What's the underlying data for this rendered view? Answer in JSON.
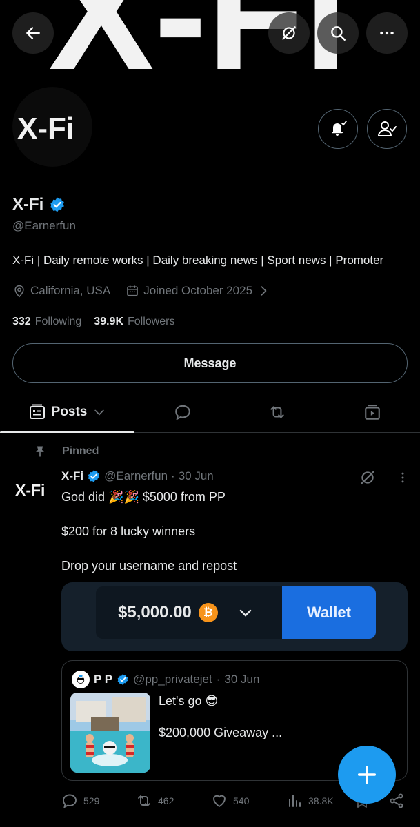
{
  "banner": {
    "logo_text": "X-Fi",
    "icons": [
      "back-arrow-icon",
      "grok-icon",
      "search-icon",
      "more-icon"
    ]
  },
  "avatar": {
    "logo_text": "X-Fi"
  },
  "profile": {
    "name": "X-Fi",
    "handle": "@Earnerfun",
    "bio": "X-Fi | Daily remote works | Daily breaking news | Sport news | Promoter",
    "location": "California, USA",
    "joined": "Joined October 2025",
    "following_count": "332",
    "following_label": "Following",
    "followers_count": "39.9K",
    "followers_label": "Followers"
  },
  "buttons": {
    "message": "Message"
  },
  "tabs": {
    "posts": "Posts"
  },
  "post": {
    "pinned_label": "Pinned",
    "author_name": "X-Fi",
    "author_handle": "@Earnerfun",
    "dot": "·",
    "date": "30 Jun",
    "line1": "God did 🎉🎉 $5000 from PP",
    "line2": "$200 for 8 lucky winners",
    "line3": "Drop your username and repost",
    "wallet_amount": "$5,000.00",
    "wallet_coin": "₿",
    "wallet_button": "Wallet",
    "quote": {
      "author_name": "P P",
      "author_handle": "@pp_privatejet",
      "dot": "·",
      "date": "30 Jun",
      "line1": "Let's go 😎",
      "line2": "$200,000 Giveaway ..."
    },
    "stats": {
      "replies": "529",
      "reposts": "462",
      "likes": "540",
      "views": "38.8K"
    }
  },
  "colors": {
    "accent": "#1d9bf0",
    "muted": "#71767b",
    "border": "#2f3336",
    "wallet_blue": "#1a6ee0"
  }
}
